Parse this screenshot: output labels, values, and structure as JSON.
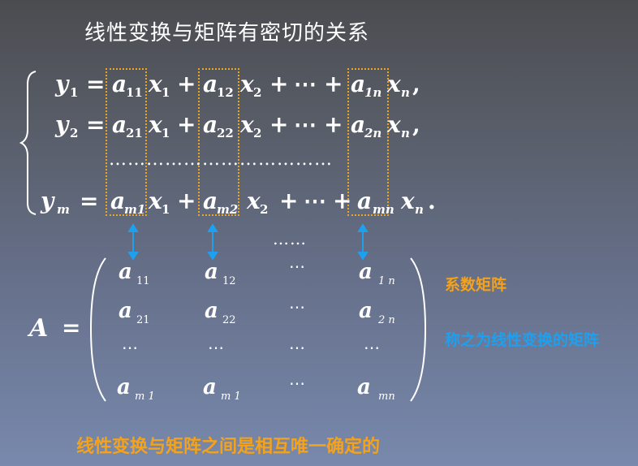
{
  "title": "线性变换与矩阵有密切的关系",
  "labels": {
    "coef_matrix": "系数矩阵",
    "called_matrix": "称之为线性变换的矩阵",
    "conclusion": "线性变换与矩阵之间是相互唯一确定的"
  },
  "system": {
    "row1": {
      "lhs": "y",
      "lhs_sub": "1",
      "eq": "=",
      "a1": "a",
      "a1_sub": "11",
      "x1": "x",
      "x1_sub": "1",
      "plus1": "+",
      "a2": "a",
      "a2_sub": "12",
      "x2": "x",
      "x2_sub": "2",
      "plus2": "+",
      "cdots": "⋯",
      "plus3": "+",
      "an": "a",
      "an_sub": "1n",
      "xn": "x",
      "xn_sub": "n",
      "end": ","
    },
    "row2": {
      "lhs": "y",
      "lhs_sub": "2",
      "eq": "=",
      "a1": "a",
      "a1_sub": "21",
      "x1": "x",
      "x1_sub": "1",
      "plus1": "+",
      "a2": "a",
      "a2_sub": "22",
      "x2": "x",
      "x2_sub": "2",
      "plus2": "+",
      "cdots": "⋯",
      "plus3": "+",
      "an": "a",
      "an_sub": "2n",
      "xn": "x",
      "xn_sub": "n",
      "end": ","
    },
    "row_dots": "………………………………",
    "row3": {
      "lhs": "y",
      "lhs_sub": "m",
      "eq": "=",
      "a1": "a",
      "a1_sub": "m1",
      "x1": "x",
      "x1_sub": "1",
      "plus1": "+",
      "a2": "a",
      "a2_sub": "m2",
      "x2": "x",
      "x2_sub": "2",
      "plus2": "+",
      "cdots": "⋯",
      "plus3": "+",
      "an": "a",
      "an_sub": "mn",
      "xn": "x",
      "xn_sub": "n",
      "end": "."
    }
  },
  "mid_dots": "……",
  "matrix": {
    "name": "A",
    "eq": "=",
    "r1": [
      {
        "a": "a",
        "s": "11"
      },
      {
        "a": "a",
        "s": "12"
      },
      {
        "a": "⋯",
        "s": ""
      },
      {
        "a": "a",
        "s": "1 n"
      }
    ],
    "r2": [
      {
        "a": "a",
        "s": "21"
      },
      {
        "a": "a",
        "s": "22"
      },
      {
        "a": "⋯",
        "s": ""
      },
      {
        "a": "a",
        "s": "2 n"
      }
    ],
    "r3": [
      {
        "a": "⋯",
        "s": ""
      },
      {
        "a": "⋯",
        "s": ""
      },
      {
        "a": "⋯",
        "s": ""
      },
      {
        "a": "⋯",
        "s": ""
      }
    ],
    "r4": [
      {
        "a": "a",
        "s": "m 1"
      },
      {
        "a": "a",
        "s": "m 1"
      },
      {
        "a": "⋯",
        "s": ""
      },
      {
        "a": "a",
        "s": "mn"
      }
    ]
  },
  "colors": {
    "accent_orange": "#f5a21b",
    "accent_blue": "#1ea0ef",
    "box_border": "#f0a418"
  }
}
